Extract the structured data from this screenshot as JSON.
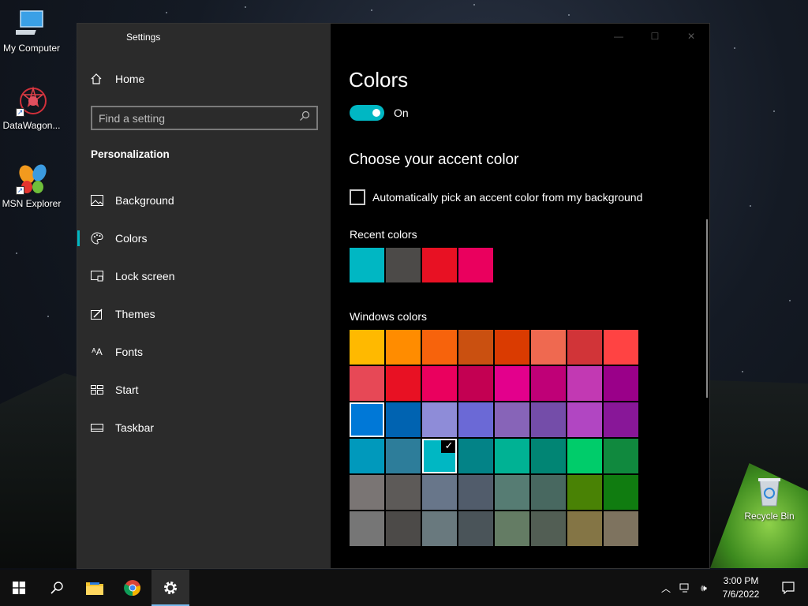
{
  "desktop": {
    "icons": [
      {
        "label": "My Computer"
      },
      {
        "label": "DataWagon..."
      },
      {
        "label": "MSN Explorer"
      },
      {
        "label": "Recycle Bin"
      }
    ]
  },
  "window": {
    "title": "Settings"
  },
  "nav": {
    "home_label": "Home",
    "search_placeholder": "Find a setting",
    "section": "Personalization",
    "items": [
      {
        "label": "Background",
        "icon": "image-icon"
      },
      {
        "label": "Colors",
        "icon": "palette-icon",
        "active": true
      },
      {
        "label": "Lock screen",
        "icon": "lock-screen-icon"
      },
      {
        "label": "Themes",
        "icon": "themes-icon"
      },
      {
        "label": "Fonts",
        "icon": "fonts-icon"
      },
      {
        "label": "Start",
        "icon": "start-icon"
      },
      {
        "label": "Taskbar",
        "icon": "taskbar-icon"
      }
    ]
  },
  "main": {
    "title": "Colors",
    "toggle_label": "On",
    "accent_heading": "Choose your accent color",
    "auto_pick_label": "Automatically pick an accent color from my background",
    "recent_label": "Recent colors",
    "windows_label": "Windows colors",
    "recent_colors": [
      "#00b7c3",
      "#4c4a48",
      "#e81123",
      "#ea005e"
    ],
    "windows_colors": [
      "#ffb900",
      "#ff8c00",
      "#f7630c",
      "#ca5010",
      "#da3b01",
      "#ef6950",
      "#d13438",
      "#ff4343",
      "#e74856",
      "#e81123",
      "#ea005e",
      "#c30052",
      "#e3008c",
      "#bf0077",
      "#c239b3",
      "#9a0089",
      "#0078d7",
      "#0063b1",
      "#8e8cd8",
      "#6b69d6",
      "#8764b8",
      "#744da9",
      "#b146c2",
      "#881798",
      "#0099bc",
      "#2d7d9a",
      "#00b7c3",
      "#038387",
      "#00b294",
      "#018574",
      "#00cc6a",
      "#10893e",
      "#7a7574",
      "#5d5a58",
      "#68768a",
      "#515c6b",
      "#567c73",
      "#486860",
      "#498205",
      "#107c10",
      "#767676",
      "#4c4a48",
      "#69797e",
      "#4a5459",
      "#647c64",
      "#525e54",
      "#847545",
      "#7e735f"
    ],
    "selected_index": 26,
    "outlined_index": 16
  },
  "taskbar": {
    "time": "3:00 PM",
    "date": "7/6/2022"
  }
}
